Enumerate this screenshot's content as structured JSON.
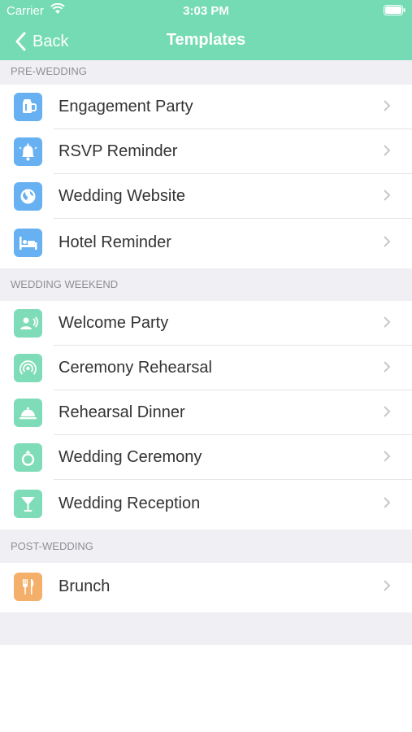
{
  "status_bar": {
    "carrier": "Carrier",
    "time": "3:03 PM"
  },
  "nav": {
    "back_label": "Back",
    "title": "Templates"
  },
  "sections": [
    {
      "header": "PRE-WEDDING",
      "items": [
        {
          "label": "Engagement Party",
          "icon": "beer-mug-icon"
        },
        {
          "label": "RSVP Reminder",
          "icon": "bell-icon"
        },
        {
          "label": "Wedding Website",
          "icon": "globe-icon"
        },
        {
          "label": "Hotel Reminder",
          "icon": "bed-icon"
        }
      ]
    },
    {
      "header": "WEDDING WEEKEND",
      "items": [
        {
          "label": "Welcome Party",
          "icon": "person-speaking-icon"
        },
        {
          "label": "Ceremony Rehearsal",
          "icon": "broadcast-icon"
        },
        {
          "label": "Rehearsal Dinner",
          "icon": "cloche-icon"
        },
        {
          "label": "Wedding Ceremony",
          "icon": "ring-icon"
        },
        {
          "label": "Wedding Reception",
          "icon": "cocktail-icon"
        }
      ]
    },
    {
      "header": "POST-WEDDING",
      "items": [
        {
          "label": "Brunch",
          "icon": "fork-knife-icon"
        }
      ]
    }
  ],
  "colors": {
    "nav_bar": "#74dbb4",
    "pre_wedding_icon": "#67b1f2",
    "weekend_icon": "#7fdcb8",
    "post_wedding_icon": "#f4b06a",
    "section_header_bg": "#efeff4"
  }
}
